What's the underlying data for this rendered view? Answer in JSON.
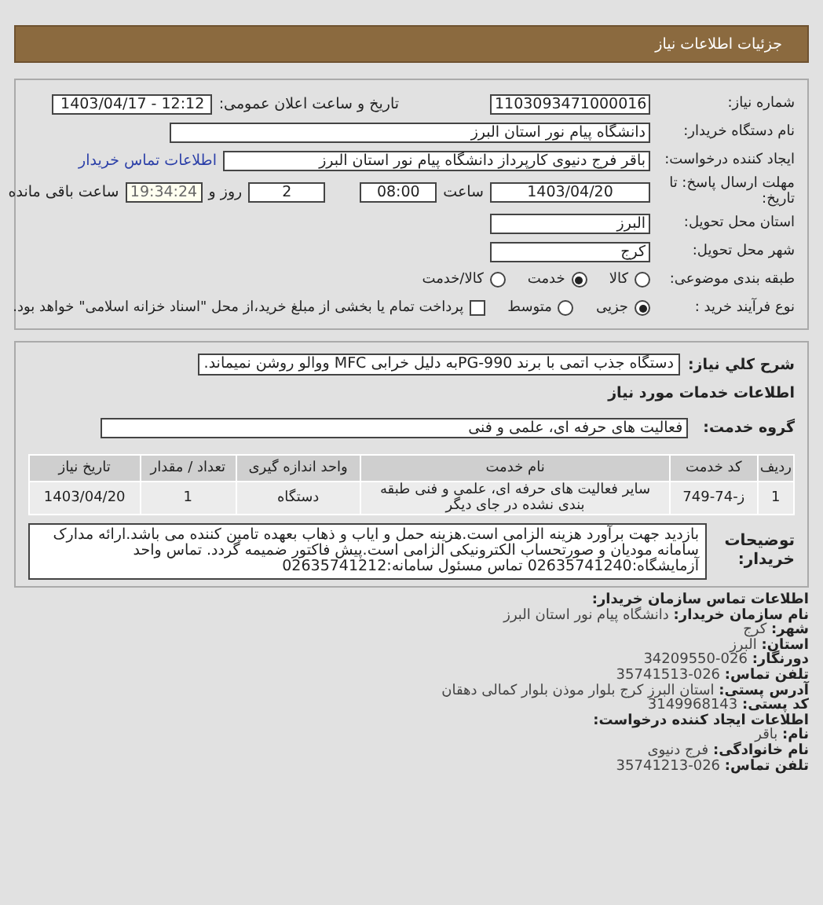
{
  "header": {
    "title": "جزئیات اطلاعات نیاز"
  },
  "need": {
    "number_label": "شماره نیاز:",
    "number": "1103093471000016",
    "announce_label": "تاریخ و ساعت اعلان عمومی:",
    "announce": "1403/04/17 - 12:12",
    "buyer_label": "نام دستگاه خریدار:",
    "buyer": "دانشگاه پیام نور استان البرز",
    "requester_label": "ایجاد کننده درخواست:",
    "requester": "باقر فرج دنیوی کارپرداز دانشگاه پیام نور استان البرز",
    "contact_link": "اطلاعات تماس خریدار",
    "deadline_label": "مهلت ارسال پاسخ: تا تاریخ:",
    "deadline_date": "1403/04/20",
    "time_label": "ساعت",
    "deadline_time": "08:00",
    "days": "2",
    "days_label": "روز و",
    "remaining": "19:34:24",
    "remaining_label": "ساعت باقی مانده",
    "province_label": "استان محل تحویل:",
    "province": "البرز",
    "city_label": "شهر محل تحویل:",
    "city": "کرج",
    "category_label": "طبقه بندی موضوعی:",
    "categories": [
      {
        "label": "کالا",
        "selected": false
      },
      {
        "label": "خدمت",
        "selected": true
      },
      {
        "label": "کالا/خدمت",
        "selected": false
      }
    ],
    "purchase_label": "نوع فرآیند خرید :",
    "purchase_types": [
      {
        "label": "جزیی",
        "selected": true
      },
      {
        "label": "متوسط",
        "selected": false
      }
    ],
    "treasury": {
      "label": "پرداخت تمام یا بخشی از مبلغ خرید،از محل \"اسناد خزانه اسلامی\" خواهد بود.",
      "checked": false
    }
  },
  "details": {
    "desc_label": "شرح کلي نیاز:",
    "desc": "دستگاه جذب اتمی با برند PG-990به دلیل خرابی MFC ووالو روشن نمیماند.",
    "services_heading": "اطلاعات خدمات مورد نیاز",
    "group_label": "گروه خدمت:",
    "group": "فعالیت های حرفه ای، علمی و فنی",
    "table": {
      "columns": [
        "ردیف",
        "کد خدمت",
        "نام خدمت",
        "واحد اندازه گیری",
        "تعداد / مقدار",
        "تاریخ نیاز"
      ],
      "rows": [
        [
          "1",
          "ز-74-749",
          "سایر فعالیت های حرفه ای، علمی و فنی طبقه بندی نشده در جای دیگر",
          "دستگاه",
          "1",
          "1403/04/20"
        ]
      ]
    },
    "notes_label": "توضیحات خریدار:",
    "notes": "بازدید جهت برآورد هزینه الزامی است.هزینه حمل و ایاب و ذهاب بعهده تامین کننده می باشد.ارائه مدارک سامانه مودیان و صورتحساب الکترونیکی الزامی است.پیش فاکتور ضمیمه گردد. تماس واحد آزمایشگاه:02635741240 تماس مسئول سامانه:02635741212"
  },
  "contact": [
    {
      "kind": "heading",
      "label": "اطلاعات تماس سازمان خریدار:"
    },
    {
      "kind": "field",
      "label": "نام سازمان خریدار:",
      "value": "دانشگاه پیام نور استان البرز"
    },
    {
      "kind": "field",
      "label": "شهر:",
      "value": "کرج"
    },
    {
      "kind": "field",
      "label": "استان:",
      "value": "البرز"
    },
    {
      "kind": "field",
      "label": "دورنگار:",
      "value": "026-34209550"
    },
    {
      "kind": "field",
      "label": "تلفن تماس:",
      "value": "026-35741513"
    },
    {
      "kind": "field",
      "label": "آدرس پستی:",
      "value": "استان البرز کرج بلوار موذن بلوار کمالی دهقان"
    },
    {
      "kind": "field",
      "label": "کد پستی:",
      "value": "3149968143"
    },
    {
      "kind": "heading",
      "label": "اطلاعات ایجاد کننده درخواست:"
    },
    {
      "kind": "field",
      "label": "نام:",
      "value": "باقر"
    },
    {
      "kind": "field",
      "label": "نام خانوادگی:",
      "value": "فرج دنیوی"
    },
    {
      "kind": "field",
      "label": "تلفن تماس:",
      "value": "026-35741213"
    }
  ]
}
